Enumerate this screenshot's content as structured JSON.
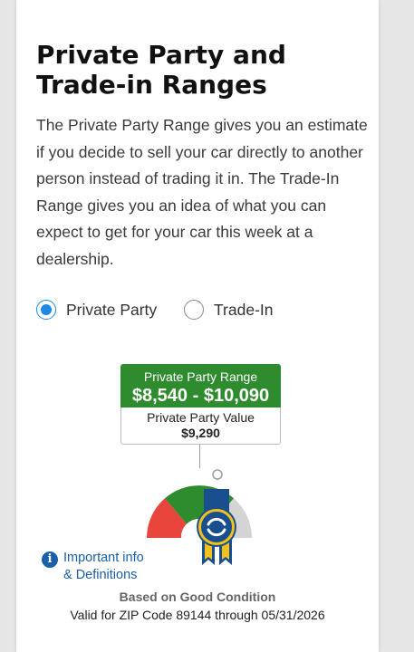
{
  "heading": {
    "line1": "Private Party and",
    "line2": "Trade-in Ranges"
  },
  "description": "The Private Party Range gives you an estimate if you decide to sell your car directly to another person instead of trading it in. The Trade-In Range gives you an idea of what you can expect to get for your car this week at a dealership.",
  "options": {
    "private_party": {
      "label": "Private Party",
      "selected": true
    },
    "trade_in": {
      "label": "Trade-In",
      "selected": false
    }
  },
  "range": {
    "title": "Private Party Range",
    "value": "$8,540 - $10,090"
  },
  "value": {
    "title": "Private Party Value",
    "amount": "$9,290"
  },
  "gauge": {
    "colors": {
      "low": "#e8453c",
      "mid": "#2e8b2e",
      "high": "#d4d4d4",
      "badge": "#1a4f8f",
      "ribbon": "#f2c21b"
    },
    "icon": "kbb-ribbon-badge-icon"
  },
  "info": {
    "line1": "Important info",
    "line2": "& Definitions",
    "icon": "info-icon"
  },
  "footer": {
    "condition": "Based on Good Condition",
    "validity": "Valid for ZIP Code 89144 through 05/31/2026"
  },
  "colors": {
    "accent_blue": "#1e88e5",
    "range_green": "#2e8b2e",
    "link_blue": "#1a5fa8"
  }
}
